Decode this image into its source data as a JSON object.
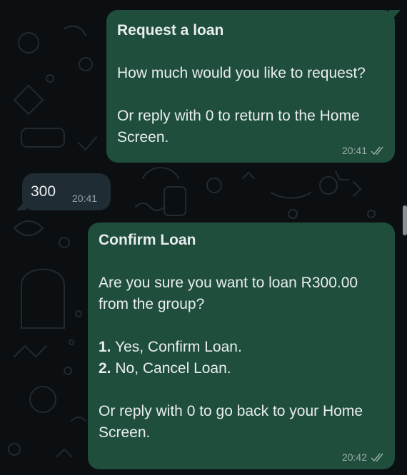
{
  "messages": [
    {
      "direction": "outgoing",
      "title": "Request a loan",
      "lines": [
        "How much would you like to request?"
      ],
      "footer": "Or reply with 0 to return to the Home Screen.",
      "time": "20:41",
      "status_icon": "double-check-icon"
    },
    {
      "direction": "incoming",
      "text": "300",
      "time": "20:41"
    },
    {
      "direction": "outgoing",
      "title": "Confirm Loan",
      "lines": [
        "Are you sure you want to loan R300.00 from the group?"
      ],
      "options": [
        {
          "num": "1.",
          "text": "Yes, Confirm Loan."
        },
        {
          "num": "2.",
          "text": "No, Cancel Loan."
        }
      ],
      "footer": "Or reply with 0 to go back to your Home Screen.",
      "time": "20:42",
      "status_icon": "double-check-icon"
    }
  ],
  "colors": {
    "background": "#0b0f12",
    "outgoing_bubble": "#1f4e3d",
    "incoming_bubble": "#202c33",
    "text": "#e9edef"
  }
}
